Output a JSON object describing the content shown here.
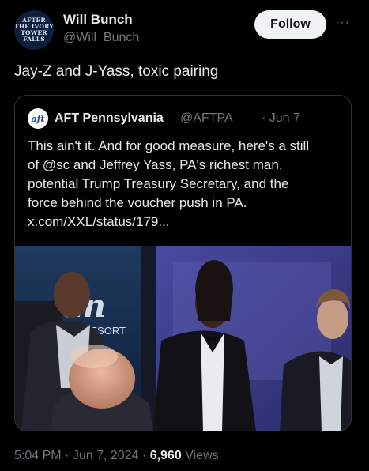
{
  "author": {
    "display_name": "Will Bunch",
    "handle": "@Will_Bunch",
    "avatar_lines": [
      "AFTER",
      "THE IVORY",
      "TOWER",
      "FALLS"
    ]
  },
  "actions": {
    "follow_label": "Follow",
    "more_label": "···"
  },
  "tweet": {
    "text": "Jay-Z and J-Yass, toxic pairing"
  },
  "quote": {
    "logo_text": "aft",
    "display_name": "AFT Pennsylvania",
    "handle": "@AFTPA",
    "date": "· Jun 7",
    "lines": [
      "This ain't it. And for good measure, here's a still",
      "of @sc and Jeffrey Yass, PA's richest man,",
      "potential Trump Treasury Secretary, and the",
      "force behind the voucher push in PA.",
      "x.com/XXL/status/179..."
    ],
    "media": {
      "sign_text": "an",
      "sign_subtext": "RESORT"
    }
  },
  "meta": {
    "time": "5:04 PM",
    "date": "Jun 7, 2024",
    "views_count": "6,960",
    "views_label": "Views"
  },
  "colors": {
    "background": "#000000",
    "text_primary": "#e7e9ea",
    "text_secondary": "#71767b",
    "follow_button_bg": "#eff3f4",
    "border": "#2f3336"
  }
}
